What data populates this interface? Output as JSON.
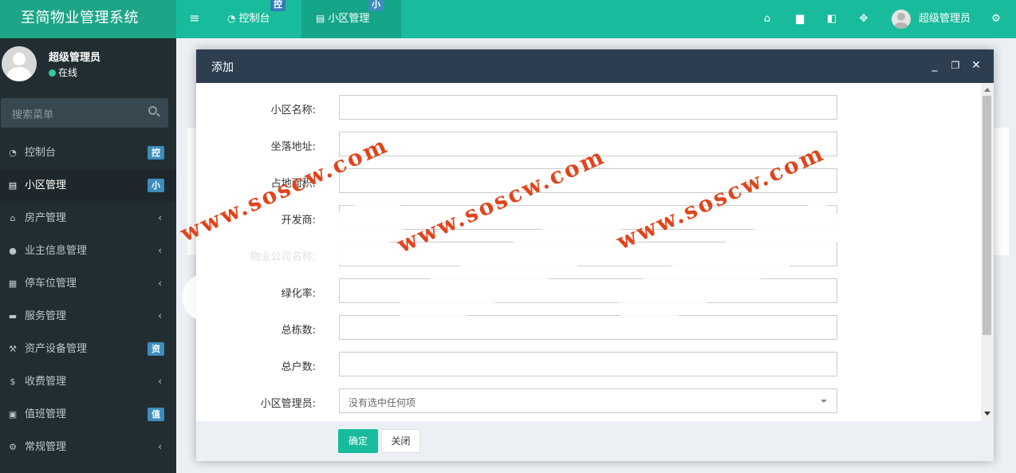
{
  "brand": {
    "title": "至简物业管理系统"
  },
  "topbar": {
    "menu_toggle_glyph": "≡",
    "tabs": [
      {
        "label": "控制台",
        "badge": "控",
        "icon": "dashboard-icon"
      },
      {
        "label": "小区管理",
        "badge": "小",
        "icon": "list-icon"
      }
    ],
    "right_icons": [
      "home-icon",
      "trash-icon",
      "language-icon",
      "fullscreen-icon"
    ],
    "user_name": "超级管理员",
    "settings_icon": "cogs-icon"
  },
  "sidebar": {
    "user_name": "超级管理员",
    "status": "在线",
    "search_placeholder": "搜索菜单",
    "items": [
      {
        "label": "控制台",
        "badge": "控",
        "icon": "dashboard-icon"
      },
      {
        "label": "小区管理",
        "badge": "小",
        "icon": "list-icon",
        "active": true
      },
      {
        "label": "房产管理",
        "chevron": "‹",
        "icon": "home-icon"
      },
      {
        "label": "业主信息管理",
        "chevron": "‹",
        "icon": "user-icon"
      },
      {
        "label": "停车位管理",
        "chevron": "‹",
        "icon": "film-icon"
      },
      {
        "label": "服务管理",
        "chevron": "‹",
        "icon": "coffee-icon"
      },
      {
        "label": "资产设备管理",
        "badge": "资",
        "icon": "gavel-icon"
      },
      {
        "label": "收费管理",
        "chevron": "‹",
        "icon": "dollar-icon"
      },
      {
        "label": "值班管理",
        "badge": "值",
        "icon": "calendar-icon"
      },
      {
        "label": "常规管理",
        "chevron": "‹",
        "icon": "cogs-icon"
      }
    ]
  },
  "modal": {
    "title": "添加",
    "controls": {
      "minimize": "_",
      "maximize": "❐",
      "close": "✕"
    },
    "fields": [
      {
        "label": "小区名称:",
        "value": ""
      },
      {
        "label": "坐落地址:",
        "value": ""
      },
      {
        "label": "占地面积:",
        "value": ""
      },
      {
        "label": "开发商:",
        "value": ""
      },
      {
        "label": "物业公司名称:",
        "value": ""
      },
      {
        "label": "绿化率:",
        "value": ""
      },
      {
        "label": "总栋数:",
        "value": ""
      },
      {
        "label": "总户数:",
        "value": ""
      }
    ],
    "manager_field": {
      "label": "小区管理员:",
      "value": "没有选中任何项"
    },
    "ok_button": "确定",
    "close_button": "关闭"
  },
  "watermark": {
    "text": "www.soscw.com"
  },
  "colors": {
    "brand_bg": "#1ea588",
    "topbar_bg": "#18bc9c",
    "sidebar_bg": "#222d32",
    "modal_header": "#2c3e50",
    "badge_blue": "#3c8dbc",
    "watermark": "#e0441c"
  }
}
